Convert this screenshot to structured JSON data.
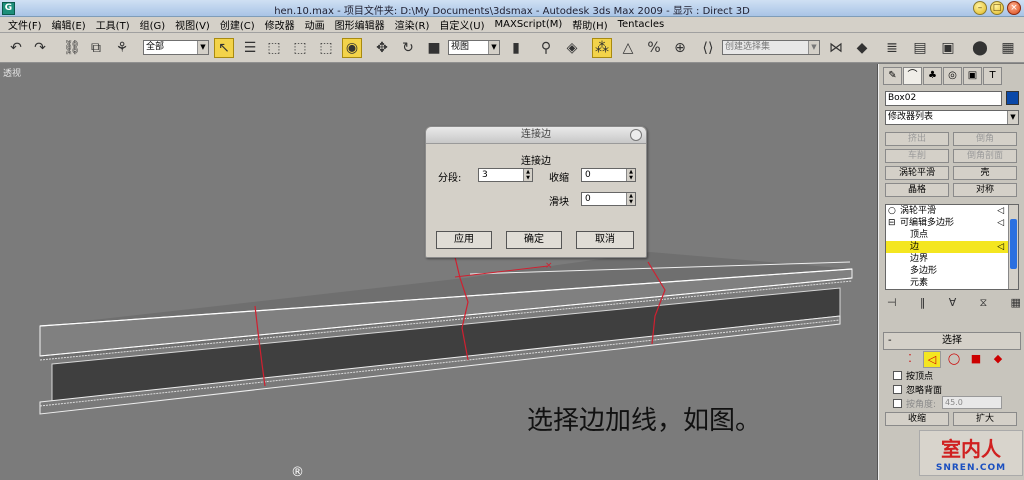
{
  "window": {
    "title": "hen.10.max    - 项目文件夹: D:\\My Documents\\3dsmax    - Autodesk 3ds Max  2009    - 显示 : Direct 3D",
    "app_icon": "G"
  },
  "menu": [
    "文件(F)",
    "编辑(E)",
    "工具(T)",
    "组(G)",
    "视图(V)",
    "创建(C)",
    "修改器",
    "动画",
    "图形编辑器",
    "渲染(R)",
    "自定义(U)",
    "MAXScript(M)",
    "帮助(H)",
    "Tentacles"
  ],
  "toolbar": {
    "selection_filter": "全部",
    "reference_coord": "视图",
    "named_selection_placeholder": "创建选择集"
  },
  "viewport": {
    "label": "透视",
    "caption": "选择边加线，如图。",
    "reg_mark": "®"
  },
  "dialog": {
    "title": "连接边",
    "heading": "连接边",
    "segments_label": "分段:",
    "segments_value": "3",
    "pinch_label": "收缩",
    "pinch_value": "0",
    "slide_label": "滑块",
    "slide_value": "0",
    "apply": "应用",
    "ok": "确定",
    "cancel": "取消"
  },
  "command_panel": {
    "object_name": "Box02",
    "object_color": "#0a48a8",
    "modifier_list": "修改器列表",
    "buttons": [
      {
        "label": "挤出",
        "disabled": true
      },
      {
        "label": "倒角",
        "disabled": true
      },
      {
        "label": "车削",
        "disabled": true
      },
      {
        "label": "倒角剖面",
        "disabled": true
      },
      {
        "label": "涡轮平滑",
        "disabled": false
      },
      {
        "label": "壳",
        "disabled": false
      },
      {
        "label": "晶格",
        "disabled": false
      },
      {
        "label": "对称",
        "disabled": false
      }
    ],
    "stack": [
      {
        "label": "涡轮平滑",
        "prefix": "💡",
        "selected": false
      },
      {
        "label": "可编辑多边形",
        "prefix": "⊟",
        "selected": false
      },
      {
        "label": "顶点",
        "prefix": "",
        "selected": false
      },
      {
        "label": "边",
        "prefix": "",
        "selected": true
      },
      {
        "label": "边界",
        "prefix": "",
        "selected": false
      },
      {
        "label": "多边形",
        "prefix": "",
        "selected": false
      },
      {
        "label": "元素",
        "prefix": "",
        "selected": false
      }
    ],
    "rollout_title": "选择",
    "rollout_toggle": "-",
    "by_vertex": "按顶点",
    "ignore_backfacing": "忽略背面",
    "by_angle": "按角度:",
    "angle_value": "45.0",
    "shrink": "收缩",
    "grow": "扩大"
  },
  "watermark": {
    "main": "室内人",
    "sub": "SNREN.COM"
  }
}
